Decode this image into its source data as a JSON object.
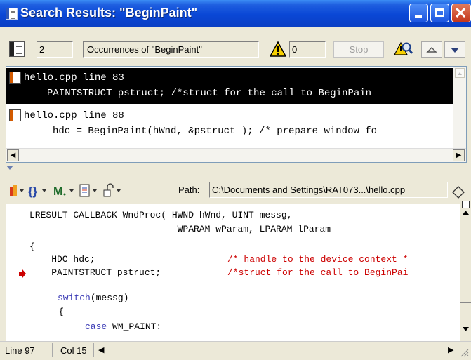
{
  "window": {
    "title": "Search Results: \"BeginPaint\""
  },
  "toolbar": {
    "count": "2",
    "occurrences_label": "Occurrences of \"BeginPaint\"",
    "warnings_count": "0",
    "stop_label": "Stop"
  },
  "results": [
    {
      "header": "hello.cpp line 83",
      "line": "PAINTSTRUCT pstruct;  /*struct for the call to BeginPain",
      "selected": true
    },
    {
      "header": "hello.cpp line 88",
      "line": "hdc = BeginPaint(hWnd, &pstruct ); /* prepare window fo",
      "selected": false
    }
  ],
  "editor_toolbar": {
    "path_label": "Path:",
    "path_value": "C:\\Documents and Settings\\RAT073...\\hello.cpp"
  },
  "editor": {
    "lines": [
      {
        "text": "LRESULT CALLBACK WndProc( HWND hWnd, UINT messg,"
      },
      {
        "text": "                           WPARAM wParam, LPARAM lParam"
      },
      {
        "text": "{"
      },
      {
        "code": "    HDC hdc;",
        "comment": "/* handle to the device context *"
      },
      {
        "code": "    PAINTSTRUCT pstruct;",
        "comment": "/*struct for the call to BeginPai"
      },
      {
        "text": ""
      },
      {
        "kw": "switch",
        "rest": "(messg)"
      },
      {
        "text": "    {"
      },
      {
        "kw": "case",
        "rest": " WM_PAINT:"
      }
    ]
  },
  "status": {
    "line": "Line 97",
    "col": "Col 15"
  },
  "colors": {
    "titlebar": "#0a47d6",
    "selection": "#000000",
    "keyword": "#3a3ab5",
    "comment": "#cc0000",
    "breakpoint_arrow": "#cc0000"
  }
}
